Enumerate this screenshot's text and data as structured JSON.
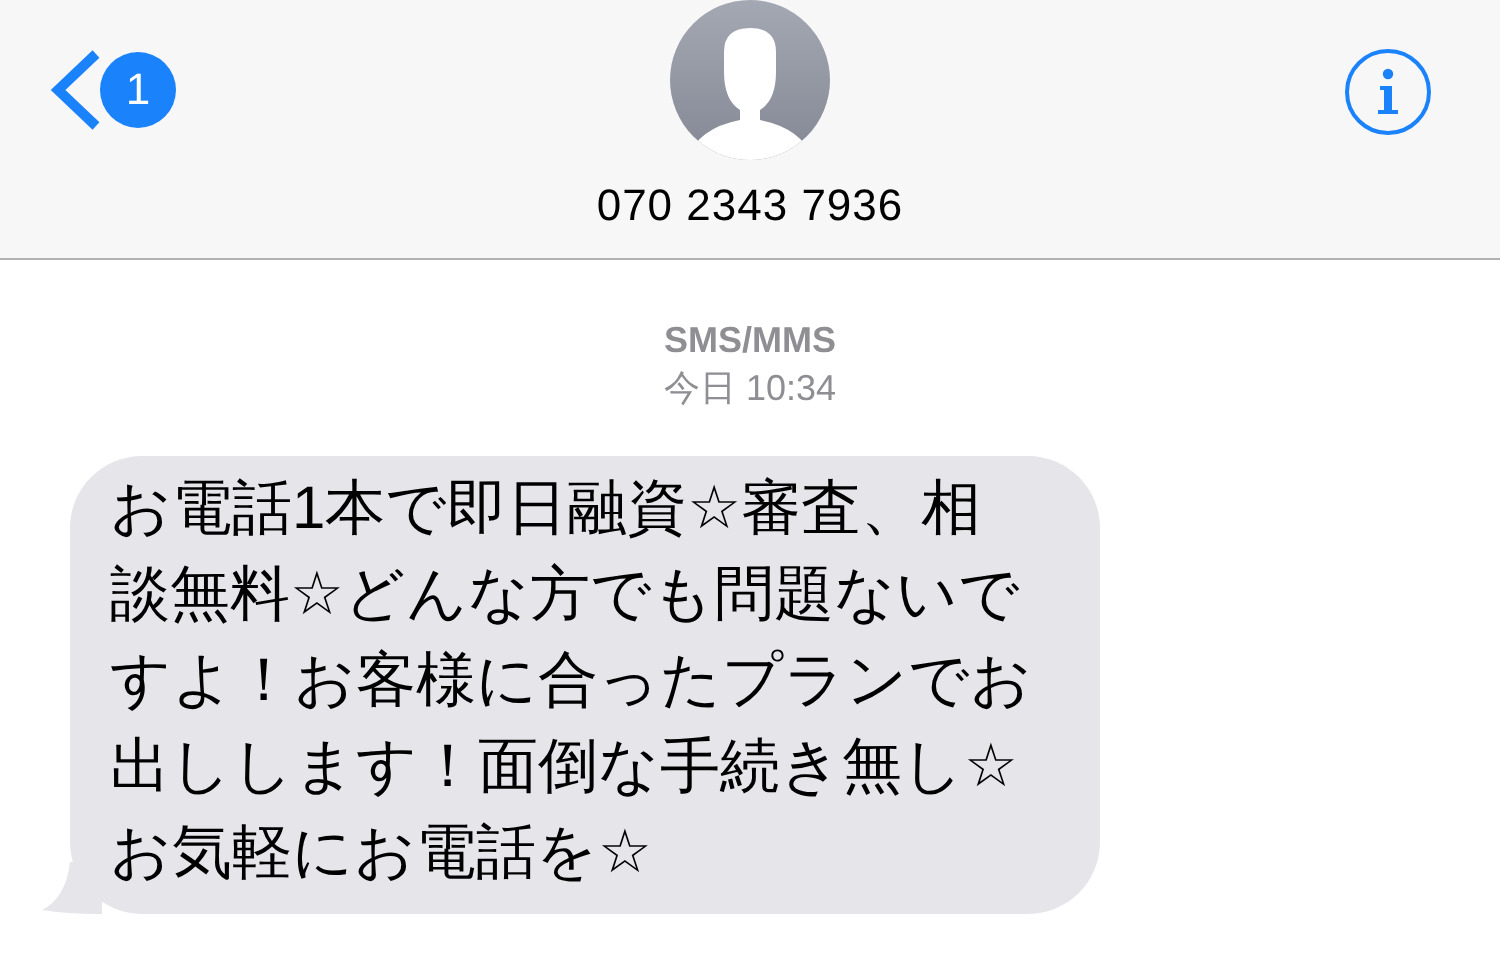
{
  "header": {
    "back_badge": "1",
    "contact": "070 2343 7936"
  },
  "thread": {
    "service": "SMS/MMS",
    "timestamp": "今日 10:34",
    "messages": [
      {
        "kind": "received",
        "lines": [
          "お電話1本で即日融資☆審査、相",
          "談無料☆どんな方でも問題ないで",
          "すよ！お客様に合ったプランでお",
          "出しします！面倒な手続き無し☆",
          "お気軽にお電話を☆"
        ]
      }
    ]
  }
}
